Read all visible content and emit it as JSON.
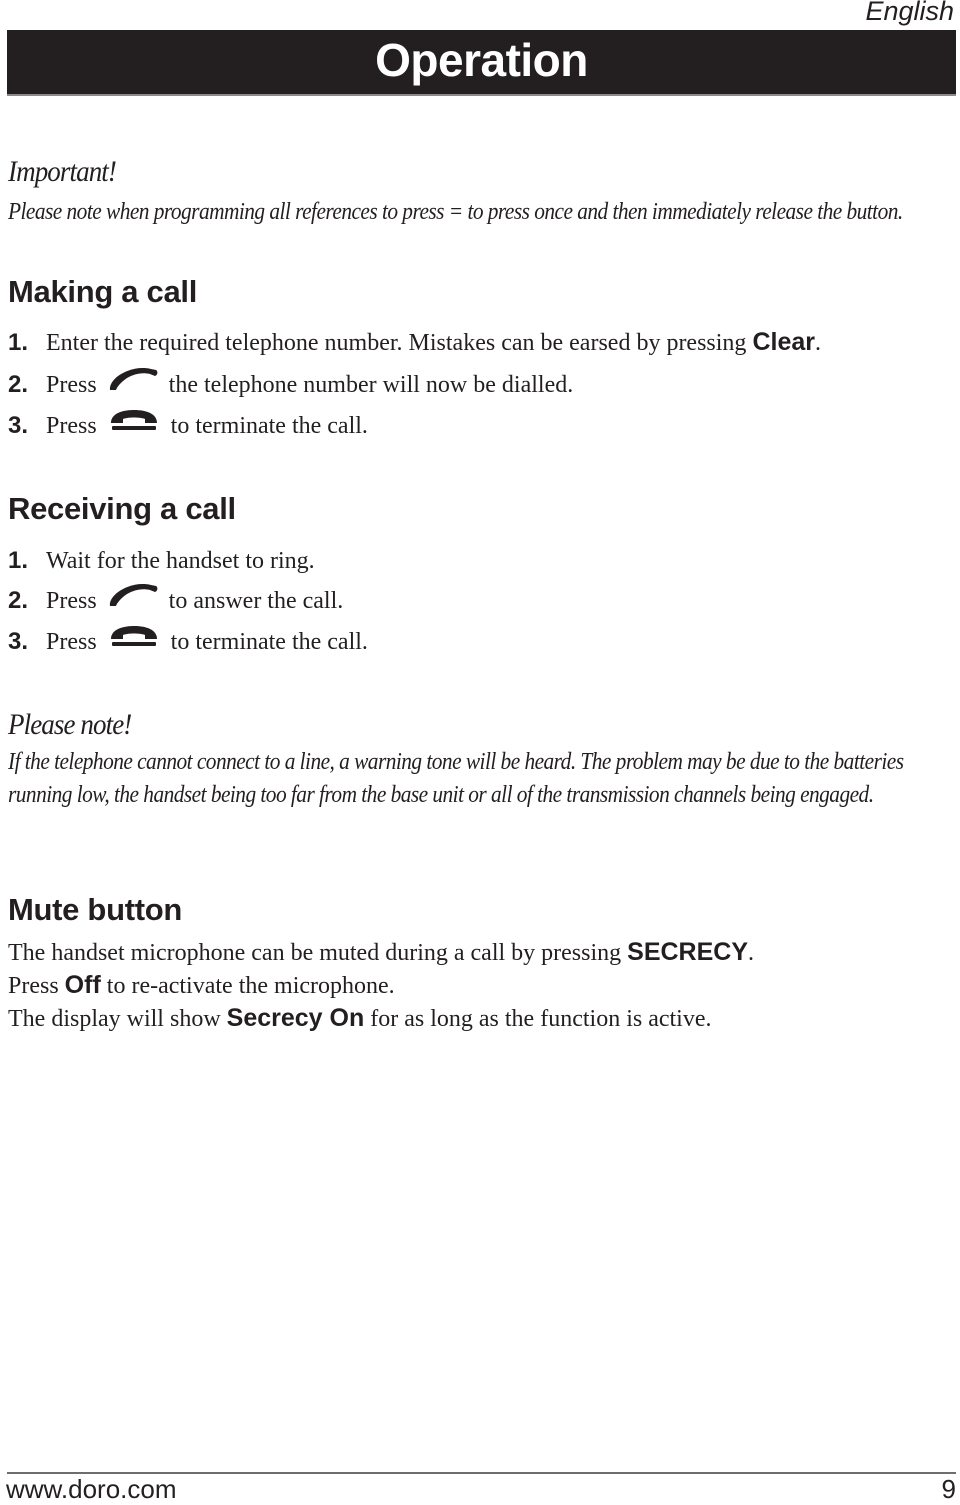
{
  "header": {
    "language": "English",
    "title": "Operation"
  },
  "important": {
    "title": "Important!",
    "text": "Please note when programming all references to press = to press once and then immediately release the button."
  },
  "making_call": {
    "heading": "Making a call",
    "steps": [
      {
        "num": "1.",
        "before": "Enter the required telephone number. Mistakes can be earsed by pressing ",
        "key": "Clear",
        "after": "."
      },
      {
        "num": "2.",
        "before": "Press",
        "icon": "phone-off-hook-icon",
        "after": "the telephone number will now be dialled."
      },
      {
        "num": "3.",
        "before": "Press",
        "icon": "phone-on-hook-icon",
        "after": "to terminate the call."
      }
    ]
  },
  "receiving_call": {
    "heading": "Receiving a call",
    "steps": [
      {
        "num": "1.",
        "before": "Wait for the handset to ring."
      },
      {
        "num": "2.",
        "before": "Press",
        "icon": "phone-off-hook-icon",
        "after": "to answer the call."
      },
      {
        "num": "3.",
        "before": "Press",
        "icon": "phone-on-hook-icon",
        "after": "to terminate the call."
      }
    ]
  },
  "please_note": {
    "title": "Please note!",
    "text": "If the telephone cannot connect to a line, a warning tone will be heard. The problem may be due to the batteries running low, the handset being too far from the base unit or all of the transmission channels being engaged."
  },
  "mute": {
    "heading": "Mute button",
    "lines": [
      {
        "before": "The handset microphone can be muted during a call by pressing ",
        "key": "SECRECY",
        "after": "."
      },
      {
        "before": "Press ",
        "key": "Off",
        "after": " to re-activate the microphone."
      },
      {
        "before": "The display will show ",
        "key": "Secrecy On",
        "after": " for as long as the function is active."
      }
    ]
  },
  "footer": {
    "url": "www.doro.com",
    "page": "9"
  }
}
